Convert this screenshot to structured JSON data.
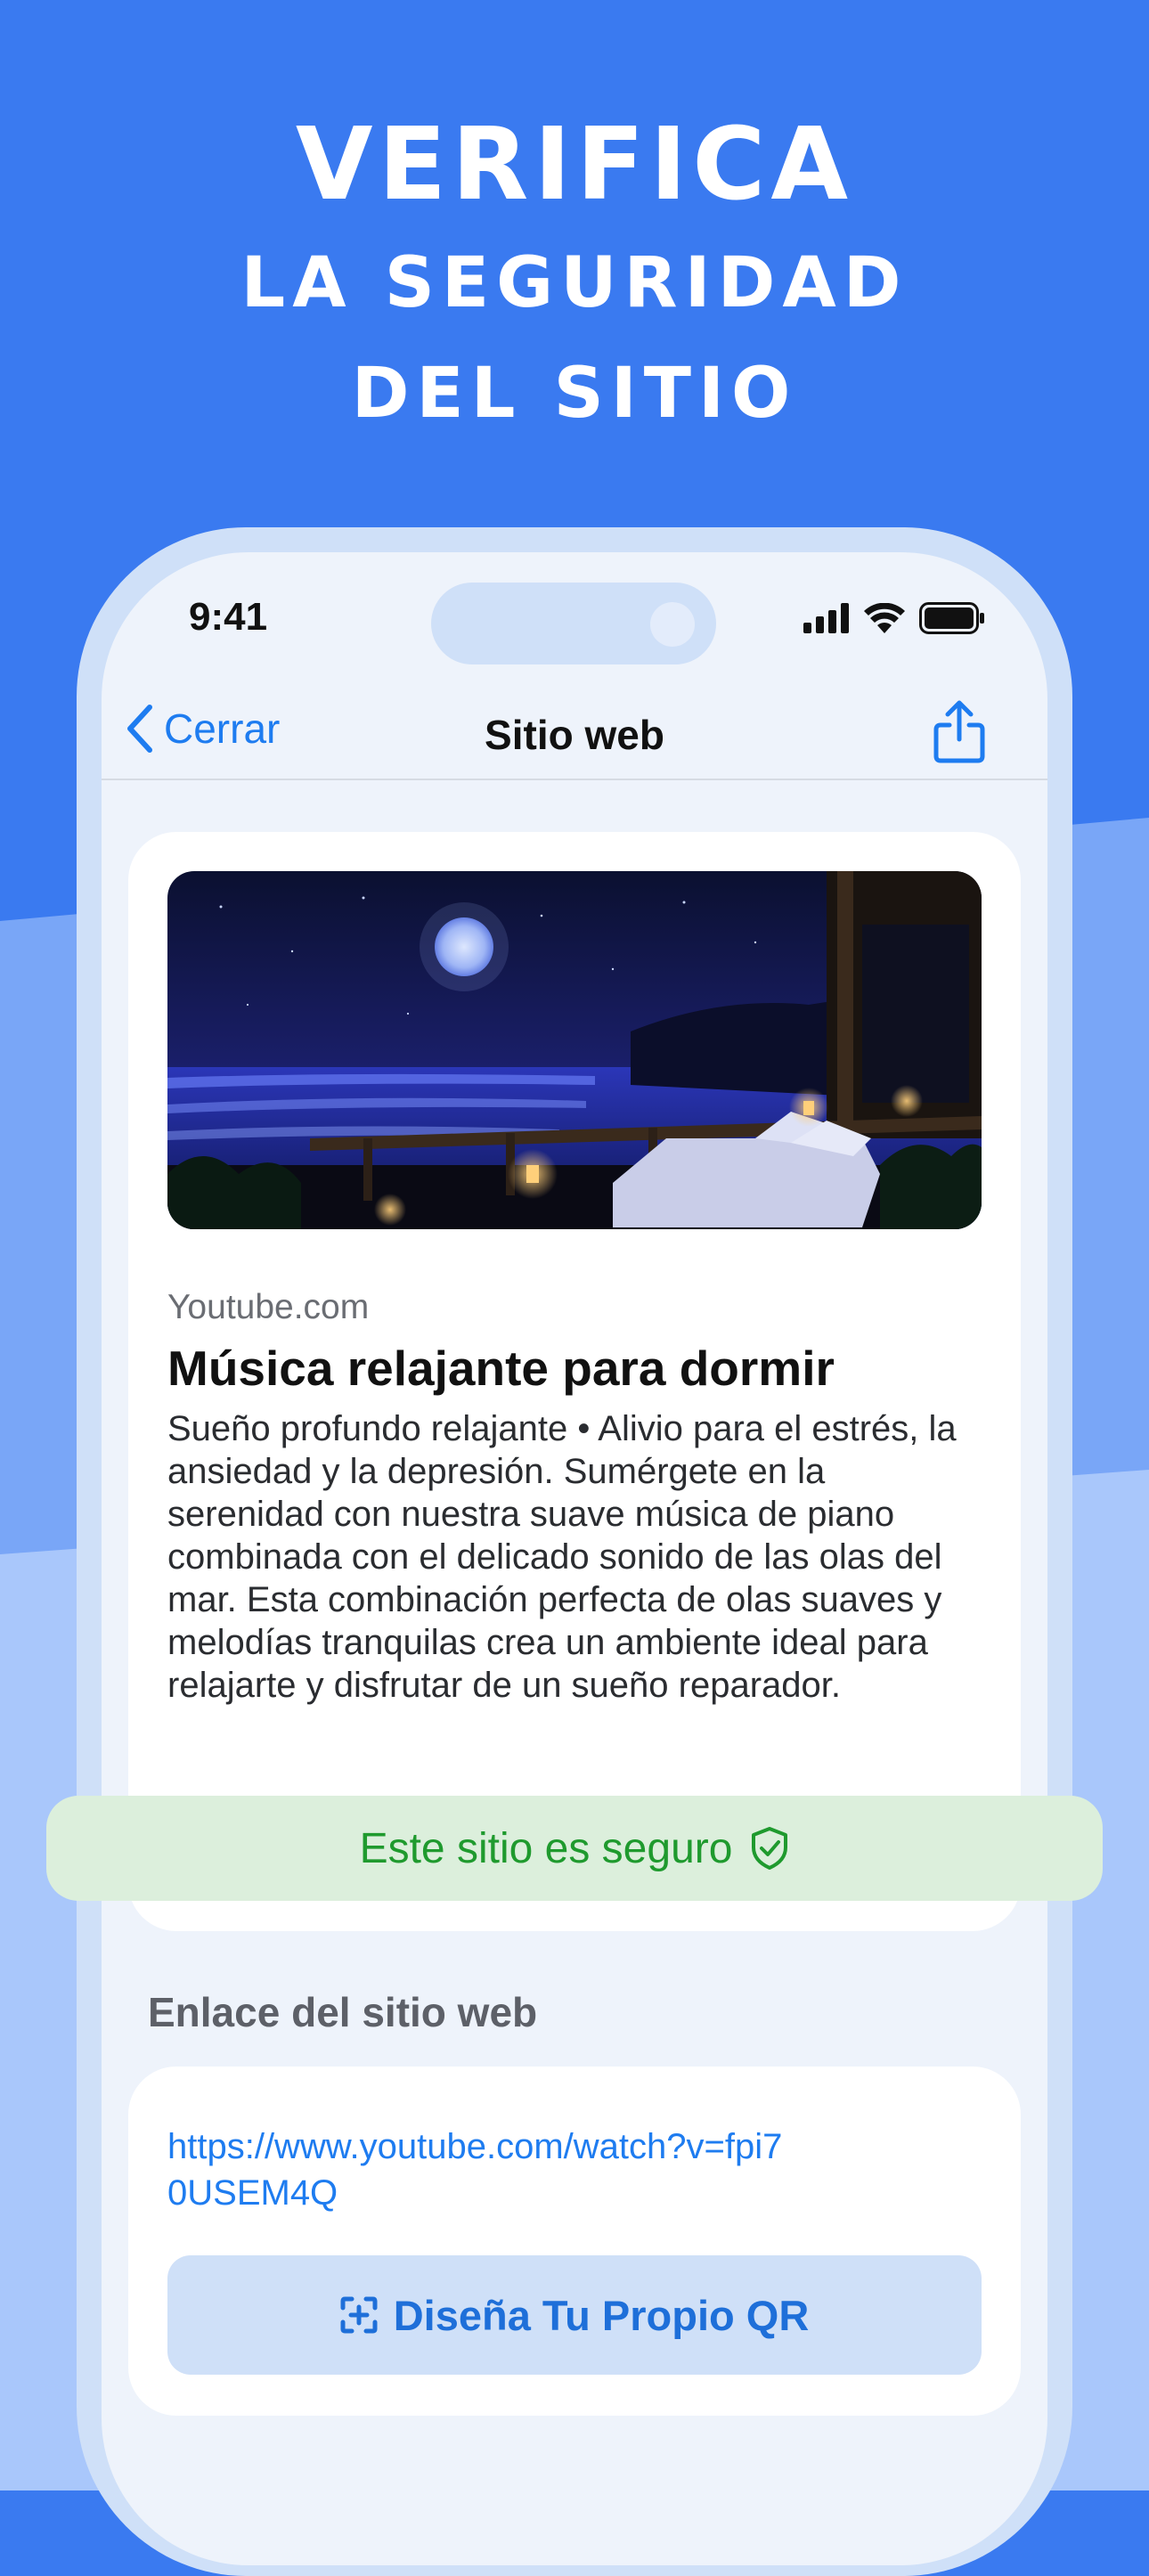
{
  "colors": {
    "background_top": "#3a7af0",
    "background_mid": "#79a6f7",
    "background_bottom": "#a9c7fb",
    "accent_blue": "#1e7cf0",
    "safe_green": "#1f9a2e",
    "safe_bg": "#dcefdc"
  },
  "headline": {
    "line1": "VERIFICA",
    "line2": "LA SEGURIDAD",
    "line3": "DEL SITIO"
  },
  "status_bar": {
    "time": "9:41",
    "icons": [
      "cellular-signal-icon",
      "wifi-icon",
      "battery-icon"
    ]
  },
  "nav": {
    "back_label": "Cerrar",
    "back_icon": "chevron-left-icon",
    "title": "Sitio web",
    "share_icon": "share-icon"
  },
  "site": {
    "thumbnail": "night-beach-terrace-image",
    "domain": "Youtube.com",
    "title": "Música relajante para dormir",
    "description": "Sueño profundo relajante • Alivio para el estrés, la ansiedad y la depresión. Sumérgete en la serenidad con nuestra suave música de piano combinada con el delicado sonido de las olas del mar. Esta combinación perfecta de olas suaves y melodías tranquilas crea un ambiente ideal para relajarte y disfrutar de un sueño reparador."
  },
  "safety": {
    "label": "Este sitio es seguro",
    "icon": "shield-check-icon"
  },
  "link_section": {
    "label": "Enlace del sitio web",
    "url": "https://www.youtube.com/watch?v=fpi70USEM4Q"
  },
  "qr_button": {
    "label": "Diseña Tu Propio QR",
    "icon": "qr-scan-plus-icon"
  }
}
